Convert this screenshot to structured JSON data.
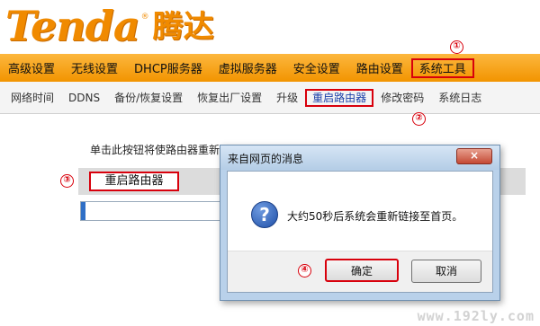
{
  "logo": {
    "latin": "Tenda",
    "reg": "®",
    "cn": "腾达"
  },
  "main_nav": [
    {
      "label": "高级设置"
    },
    {
      "label": "无线设置"
    },
    {
      "label": "DHCP服务器"
    },
    {
      "label": "虚拟服务器"
    },
    {
      "label": "安全设置"
    },
    {
      "label": "路由设置"
    },
    {
      "label": "系统工具",
      "selected": true
    }
  ],
  "sub_nav": [
    {
      "label": "网络时间"
    },
    {
      "label": "DDNS"
    },
    {
      "label": "备份/恢复设置"
    },
    {
      "label": "恢复出厂设置"
    },
    {
      "label": "升级"
    },
    {
      "label": "重启路由器",
      "selected": true
    },
    {
      "label": "修改密码"
    },
    {
      "label": "系统日志"
    }
  ],
  "content": {
    "instruction": "单击此按钮将使路由器重新",
    "reboot_button": "重启路由器",
    "progress_fraction": 0.03
  },
  "dialog": {
    "title": "来自网页的消息",
    "close_symbol": "×",
    "question_symbol": "?",
    "message": "大约50秒后系统会重新链接至首页。",
    "ok_label": "确定",
    "cancel_label": "取消"
  },
  "callouts": {
    "c1": "①",
    "c2": "②",
    "c3": "③",
    "c4": "④"
  },
  "watermark": "www.192ly.com",
  "colors": {
    "brand_orange": "#f08a00",
    "highlight_red": "#d8000c",
    "link_blue": "#1b3fa8"
  }
}
